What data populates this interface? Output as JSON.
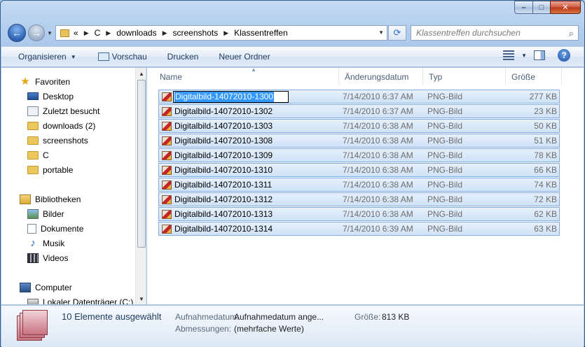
{
  "window": {
    "caption": {
      "minimize": "–",
      "maximize": "□",
      "close": "✕"
    }
  },
  "address": {
    "overflow": "«",
    "crumbs": [
      "C",
      "downloads",
      "screenshots",
      "Klassentreffen"
    ],
    "search_placeholder": "Klassentreffen durchsuchen"
  },
  "toolbar": {
    "organize": "Organisieren",
    "preview": "Vorschau",
    "print": "Drucken",
    "new_folder": "Neuer Ordner"
  },
  "nav": {
    "favorites_header": "Favoriten",
    "favorites": [
      "Desktop",
      "Zuletzt besucht",
      "downloads (2)",
      "screenshots",
      "C",
      "portable"
    ],
    "libraries_header": "Bibliotheken",
    "libraries": [
      "Bilder",
      "Dokumente",
      "Musik",
      "Videos"
    ],
    "computer_header": "Computer",
    "computer_items": [
      "Lokaler Datenträger (C:)"
    ]
  },
  "columns": {
    "name": "Name",
    "date": "Änderungsdatum",
    "type": "Typ",
    "size": "Größe"
  },
  "files": [
    {
      "name": "Digitalbild-14072010-1300",
      "date": "7/14/2010 6:37 AM",
      "type": "PNG-Bild",
      "size": "277 KB",
      "renaming": true
    },
    {
      "name": "Digitalbild-14072010-1302",
      "date": "7/14/2010 6:37 AM",
      "type": "PNG-Bild",
      "size": "23 KB"
    },
    {
      "name": "Digitalbild-14072010-1303",
      "date": "7/14/2010 6:38 AM",
      "type": "PNG-Bild",
      "size": "50 KB"
    },
    {
      "name": "Digitalbild-14072010-1308",
      "date": "7/14/2010 6:38 AM",
      "type": "PNG-Bild",
      "size": "51 KB"
    },
    {
      "name": "Digitalbild-14072010-1309",
      "date": "7/14/2010 6:38 AM",
      "type": "PNG-Bild",
      "size": "78 KB"
    },
    {
      "name": "Digitalbild-14072010-1310",
      "date": "7/14/2010 6:38 AM",
      "type": "PNG-Bild",
      "size": "66 KB"
    },
    {
      "name": "Digitalbild-14072010-1311",
      "date": "7/14/2010 6:38 AM",
      "type": "PNG-Bild",
      "size": "74 KB"
    },
    {
      "name": "Digitalbild-14072010-1312",
      "date": "7/14/2010 6:38 AM",
      "type": "PNG-Bild",
      "size": "72 KB"
    },
    {
      "name": "Digitalbild-14072010-1313",
      "date": "7/14/2010 6:38 AM",
      "type": "PNG-Bild",
      "size": "62 KB"
    },
    {
      "name": "Digitalbild-14072010-1314",
      "date": "7/14/2010 6:39 AM",
      "type": "PNG-Bild",
      "size": "63 KB"
    }
  ],
  "details": {
    "selection": "10 Elemente ausgewählt",
    "date_taken_label": "Aufnahmedatum:",
    "date_taken_value": "Aufnahmedatum ange...",
    "dimensions_label": "Abmessungen:",
    "dimensions_value": "(mehrfache Werte)",
    "size_label": "Größe:",
    "size_value": "813 KB"
  },
  "colors": {
    "selection_fill": "#cfe2f7",
    "selection_border": "#84acdd",
    "rename_highlight": "#3399ff"
  }
}
